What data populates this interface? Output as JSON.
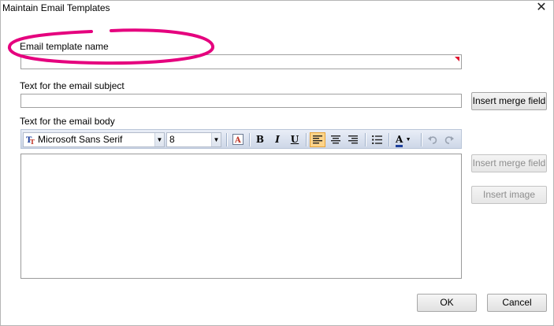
{
  "window": {
    "title": "Maintain Email Templates",
    "close_glyph": "✕"
  },
  "fields": {
    "template_name_label": "Email template name",
    "subject_label": "Text for the email subject",
    "body_label": "Text for the email body"
  },
  "buttons": {
    "insert_merge_field_subject": "Insert merge field",
    "insert_merge_field_body": "Insert merge field",
    "insert_image": "Insert image",
    "ok": "OK",
    "cancel": "Cancel"
  },
  "toolbar": {
    "font_family": "Microsoft Sans Serif",
    "font_size": "8",
    "bold": "B",
    "italic": "I",
    "underline": "U",
    "font_color_glyph": "A",
    "dropdown_glyph": "▼"
  },
  "colors": {
    "annotation": "#e5007e",
    "required_marker": "#e0142e",
    "toolbar_active": "#fdd48a"
  },
  "icons": [
    "close-icon",
    "font-family-icon",
    "font-size-icon",
    "font-style-icon",
    "bold-icon",
    "italic-icon",
    "underline-icon",
    "align-left-icon",
    "align-center-icon",
    "align-right-icon",
    "bullet-list-icon",
    "font-color-icon",
    "undo-icon",
    "redo-icon"
  ]
}
